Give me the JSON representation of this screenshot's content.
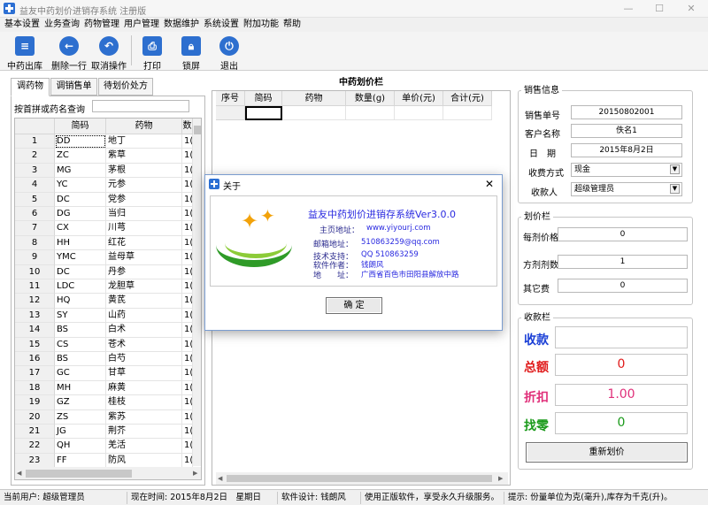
{
  "window": {
    "title": "益友中药划价进销存系统 注册版",
    "controls": [
      "—",
      "☐",
      "✕"
    ]
  },
  "menu": [
    "基本设置",
    "业务查询",
    "药物管理",
    "用户管理",
    "数据维护",
    "系统设置",
    "附加功能",
    "帮助"
  ],
  "toolbar": [
    {
      "label": "中药出库",
      "icon": "document-icon",
      "color": "#2d6fcf"
    },
    {
      "label": "删除一行",
      "icon": "arrow-left-icon",
      "color": "#2d6fcf"
    },
    {
      "label": "取消操作",
      "icon": "undo-icon",
      "color": "#2d6fcf"
    },
    {
      "label": "打印",
      "icon": "printer-icon",
      "color": "#2d6fcf"
    },
    {
      "label": "锁屏",
      "icon": "lock-icon",
      "color": "#2d6fcf"
    },
    {
      "label": "退出",
      "icon": "power-icon",
      "color": "#2d6fcf"
    }
  ],
  "left_tabs": [
    "调药物",
    "调销售单",
    "待划价处方"
  ],
  "search_label": "按首拼或药名查询",
  "drug_grid": {
    "columns": [
      "简码",
      "药物",
      "数"
    ],
    "rows": [
      {
        "no": "1",
        "code": "DD",
        "name": "地丁",
        "qty": "1("
      },
      {
        "no": "2",
        "code": "ZC",
        "name": "紫草",
        "qty": "1("
      },
      {
        "no": "3",
        "code": "MG",
        "name": "茅根",
        "qty": "1("
      },
      {
        "no": "4",
        "code": "YC",
        "name": "元参",
        "qty": "1("
      },
      {
        "no": "5",
        "code": "DC",
        "name": "党参",
        "qty": "1("
      },
      {
        "no": "6",
        "code": "DG",
        "name": "当归",
        "qty": "1("
      },
      {
        "no": "7",
        "code": "CX",
        "name": "川芎",
        "qty": "1("
      },
      {
        "no": "8",
        "code": "HH",
        "name": "红花",
        "qty": "1("
      },
      {
        "no": "9",
        "code": "YMC",
        "name": "益母草",
        "qty": "1("
      },
      {
        "no": "10",
        "code": "DC",
        "name": "丹参",
        "qty": "1("
      },
      {
        "no": "11",
        "code": "LDC",
        "name": "龙胆草",
        "qty": "1("
      },
      {
        "no": "12",
        "code": "HQ",
        "name": "黄芪",
        "qty": "1("
      },
      {
        "no": "13",
        "code": "SY",
        "name": "山药",
        "qty": "1("
      },
      {
        "no": "14",
        "code": "BS",
        "name": "白术",
        "qty": "1("
      },
      {
        "no": "15",
        "code": "CS",
        "name": "苍术",
        "qty": "1("
      },
      {
        "no": "16",
        "code": "BS",
        "name": "白芍",
        "qty": "1("
      },
      {
        "no": "17",
        "code": "GC",
        "name": "甘草",
        "qty": "1("
      },
      {
        "no": "18",
        "code": "MH",
        "name": "麻黄",
        "qty": "1("
      },
      {
        "no": "19",
        "code": "GZ",
        "name": "桂枝",
        "qty": "1("
      },
      {
        "no": "20",
        "code": "ZS",
        "name": "紫苏",
        "qty": "1("
      },
      {
        "no": "21",
        "code": "JG",
        "name": "荆芥",
        "qty": "1("
      },
      {
        "no": "22",
        "code": "QH",
        "name": "羌活",
        "qty": "1("
      },
      {
        "no": "23",
        "code": "FF",
        "name": "防风",
        "qty": "1("
      }
    ]
  },
  "pricing": {
    "title": "中药划价栏",
    "columns": [
      "序号",
      "简码",
      "药物",
      "数量(g)",
      "单价(元)",
      "合计(元)"
    ]
  },
  "sales_info": {
    "title": "销售信息",
    "fields": [
      {
        "label": "销售单号",
        "value": "20150802001"
      },
      {
        "label": "客户名称",
        "value": "佚名1"
      },
      {
        "label": "日　期",
        "value": "2015年8月2日"
      }
    ],
    "payment_label": "收费方式",
    "payment_value": "现金",
    "cashier_label": "收款人",
    "cashier_value": "超级管理员"
  },
  "price_panel": {
    "title": "划价栏",
    "fields": [
      {
        "label": "每剂价格",
        "value": "0"
      },
      {
        "label": "方剂剂数",
        "value": "1"
      },
      {
        "label": "其它费",
        "value": "0"
      }
    ]
  },
  "cashier_panel": {
    "title": "收款栏",
    "rows": [
      {
        "label": "收款",
        "value": "",
        "color": "#1a3fd6"
      },
      {
        "label": "总额",
        "value": "0",
        "color": "#e01b1b"
      },
      {
        "label": "折扣",
        "value": "1.00",
        "color": "#e0307a"
      },
      {
        "label": "找零",
        "value": "0",
        "color": "#1a9a1a"
      }
    ],
    "reset_button": "重新划价"
  },
  "status": [
    "当前用户: 超级管理员",
    "现在时间: 2015年8月2日　星期日",
    "软件设计: 钱朗风",
    "使用正版软件，享受永久升级服务。",
    "提示: 份量单位为克(毫升),库存为千克(升)。"
  ],
  "about_dialog": {
    "title": "关于",
    "product": "益友中药划价进销存系统Ver3.0.0",
    "lines": [
      {
        "label": "主页地址：",
        "value": "www.yiyourj.com"
      },
      {
        "label": "邮箱地址：",
        "value": "510863259@qq.com"
      },
      {
        "label": "技术支持：",
        "value": "QQ 510863259"
      },
      {
        "label": "软件作者：",
        "value": "钱朗风"
      },
      {
        "label": "地　　址：",
        "value": "广西省百色市田阳县解放中路"
      }
    ],
    "ok_button": "确 定"
  }
}
